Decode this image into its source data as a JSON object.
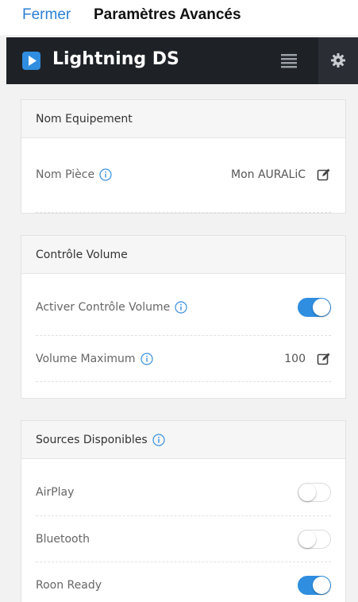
{
  "topbar": {
    "close_label": "Fermer",
    "title": "Paramètres Avancés"
  },
  "appbar": {
    "title": "Lightning DS"
  },
  "device_name": {
    "header": "Nom Equipement",
    "room_label": "Nom Pièce",
    "room_value": "Mon AURALiC"
  },
  "volume_control": {
    "header": "Contrôle Volume",
    "enable_label": "Activer Contrôle Volume",
    "enable_state": true,
    "max_label": "Volume Maximum",
    "max_value": "100"
  },
  "sources": {
    "header": "Sources Disponibles",
    "items": [
      {
        "label": "AirPlay",
        "enabled": false
      },
      {
        "label": "Bluetooth",
        "enabled": false
      },
      {
        "label": "Roon Ready",
        "enabled": true
      }
    ]
  },
  "colors": {
    "accent": "#2f8ee0",
    "appbar": "#1e2227",
    "link": "#2b7fd4"
  }
}
